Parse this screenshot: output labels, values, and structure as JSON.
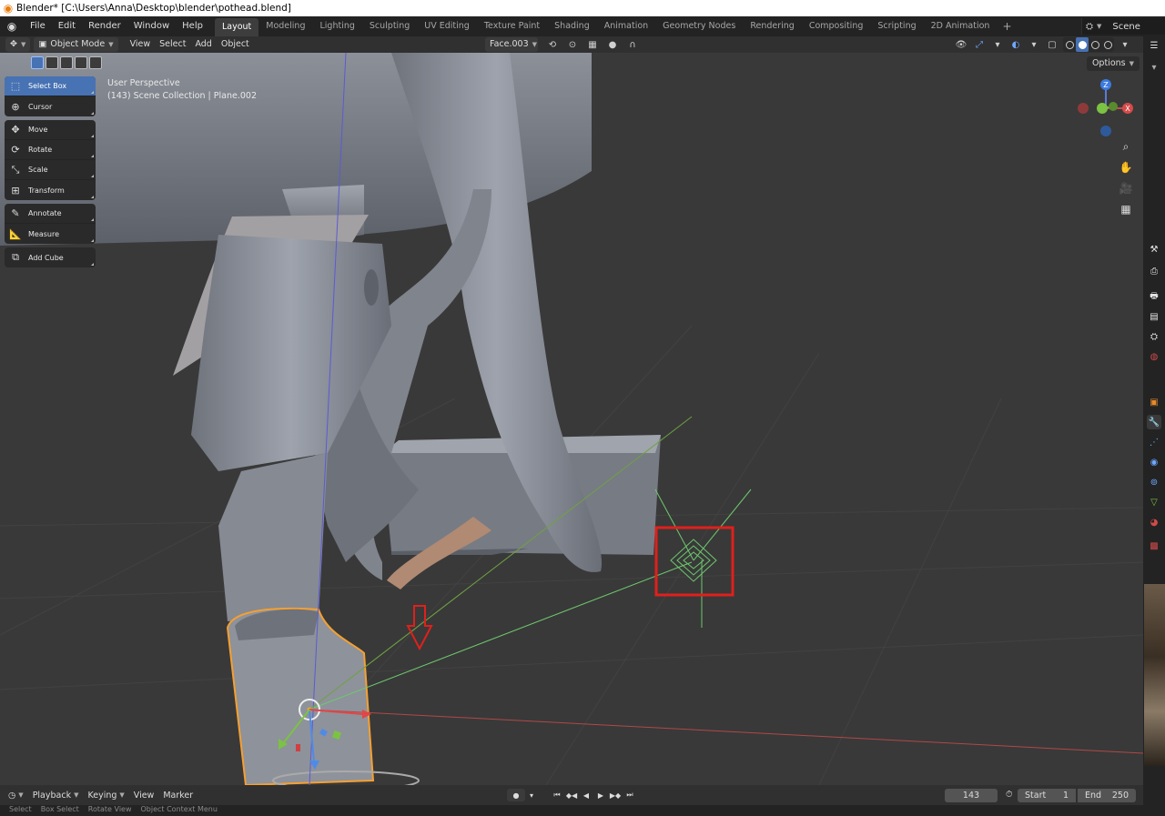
{
  "window": {
    "title": "Blender* [C:\\Users\\Anna\\Desktop\\blender\\pothead.blend]"
  },
  "topbar": {
    "menus": [
      "File",
      "Edit",
      "Render",
      "Window",
      "Help"
    ],
    "workspaces": [
      "Layout",
      "Modeling",
      "Lighting",
      "Sculpting",
      "UV Editing",
      "Texture Paint",
      "Shading",
      "Animation",
      "Geometry Nodes",
      "Rendering",
      "Compositing",
      "Scripting",
      "2D Animation"
    ],
    "active_workspace": "Layout",
    "add_symbol": "+",
    "scene": "Scene"
  },
  "viewport_header": {
    "mode": "Object Mode",
    "menus": [
      "View",
      "Select",
      "Add",
      "Object"
    ],
    "orientation": "Face.003",
    "options_label": "Options"
  },
  "overlay": {
    "view_name": "User Perspective",
    "collection_info": "(143) Scene Collection | Plane.002"
  },
  "toolbar": {
    "groups": [
      [
        {
          "label": "Select Box",
          "icon": "select-box-icon",
          "active": true
        },
        {
          "label": "Cursor",
          "icon": "cursor-icon"
        }
      ],
      [
        {
          "label": "Move",
          "icon": "move-icon"
        },
        {
          "label": "Rotate",
          "icon": "rotate-icon"
        },
        {
          "label": "Scale",
          "icon": "scale-icon"
        },
        {
          "label": "Transform",
          "icon": "transform-icon"
        }
      ],
      [
        {
          "label": "Annotate",
          "icon": "annotate-icon"
        },
        {
          "label": "Measure",
          "icon": "measure-icon"
        }
      ],
      [
        {
          "label": "Add Cube",
          "icon": "add-cube-icon"
        }
      ]
    ]
  },
  "gizmo": {
    "z": "Z",
    "x": "X"
  },
  "timeline": {
    "menus": [
      "Playback",
      "Keying",
      "View",
      "Marker"
    ],
    "current_frame": "143",
    "start_label": "Start",
    "start": "1",
    "end_label": "End",
    "end": "250"
  },
  "statusbar": {
    "items": [
      "Select",
      "Box Select",
      "Rotate View",
      "Object Context Menu"
    ]
  },
  "colors": {
    "accent": "#4772b3",
    "annotation_red": "#e0201c",
    "selection_orange": "#f5a030"
  }
}
